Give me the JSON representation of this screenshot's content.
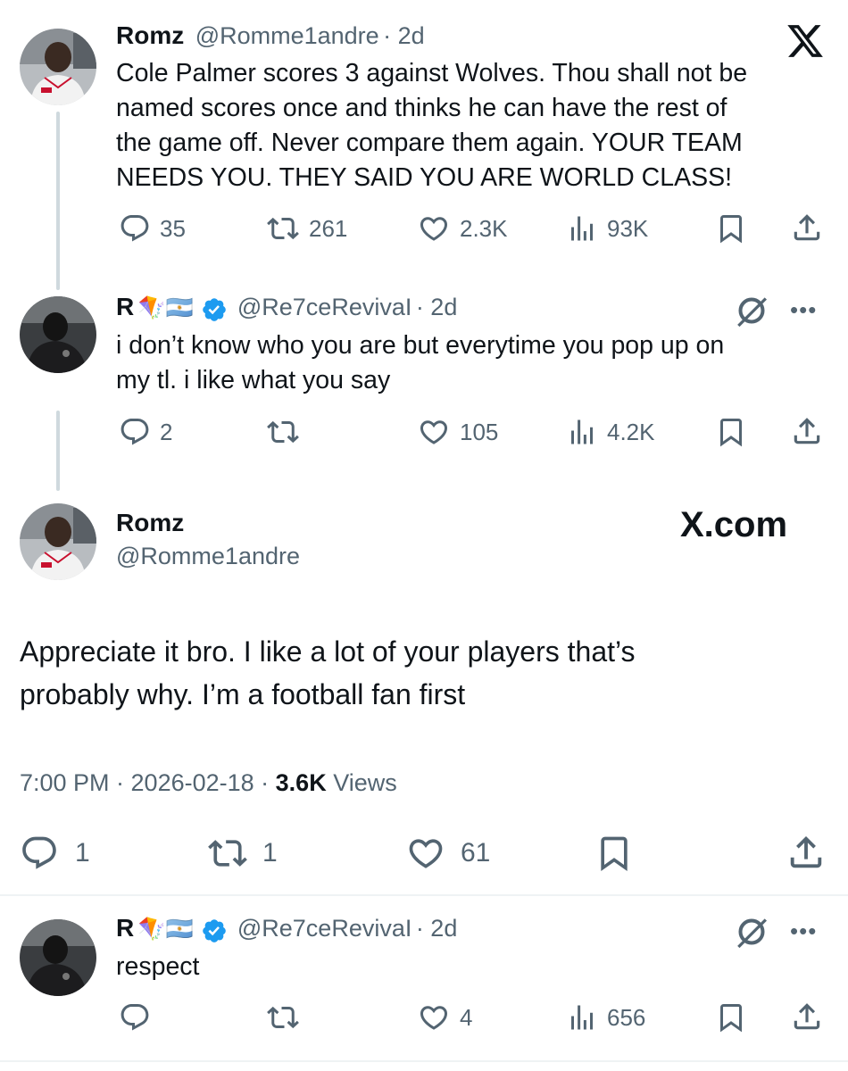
{
  "tweet1": {
    "name": "Romz",
    "handle": "@Romme1andre",
    "time": "· 2d",
    "text_lines": [
      "Cole Palmer scores 3 against Wolves. Thou shall not be",
      "named scores once and thinks he can have the rest of",
      "the game off. Never compare them again. YOUR TEAM",
      "NEEDS YOU. THEY SAID YOU ARE WORLD CLASS!"
    ],
    "replies": "35",
    "reposts": "261",
    "likes": "2.3K",
    "views": "93K"
  },
  "tweet2": {
    "name": "R",
    "flags": "🪁🇦🇷",
    "handle": "@Re7ceRevivaI",
    "time": "· 2d",
    "text_lines": [
      "i don’t know who you are but everytime you pop up on",
      "my tl. i like what you say"
    ],
    "replies": "2",
    "reposts": "",
    "likes": "105",
    "views": "4.2K"
  },
  "main_tweet": {
    "name": "Romz",
    "handle": "@Romme1andre",
    "brand": "X.com",
    "text_lines": [
      "Appreciate it bro. I like a lot of your players that’s",
      "probably why. I’m a football fan first"
    ],
    "time": "7:00 PM · 2026-02-18 · ",
    "views_count": "3.6K",
    "views_label": " Views",
    "replies": "1",
    "reposts": "1",
    "likes": "61"
  },
  "tweet3": {
    "name": "R",
    "flags": "🪁🇦🇷",
    "handle": "@Re7ceRevivaI",
    "time": "· 2d",
    "text": "respect",
    "replies": "",
    "reposts": "",
    "likes": "4",
    "views": "656"
  },
  "icons": [
    "reply-icon",
    "repost-icon",
    "like-icon",
    "views-icon",
    "bookmark-icon",
    "share-icon",
    "x-logo-icon",
    "grok-icon",
    "more-icon",
    "verified-icon"
  ],
  "colors": {
    "text": "#0f1419",
    "secondary": "#536471",
    "verified": "#1d9bf0",
    "divider": "#eff3f4",
    "thread": "#cfd9de"
  }
}
